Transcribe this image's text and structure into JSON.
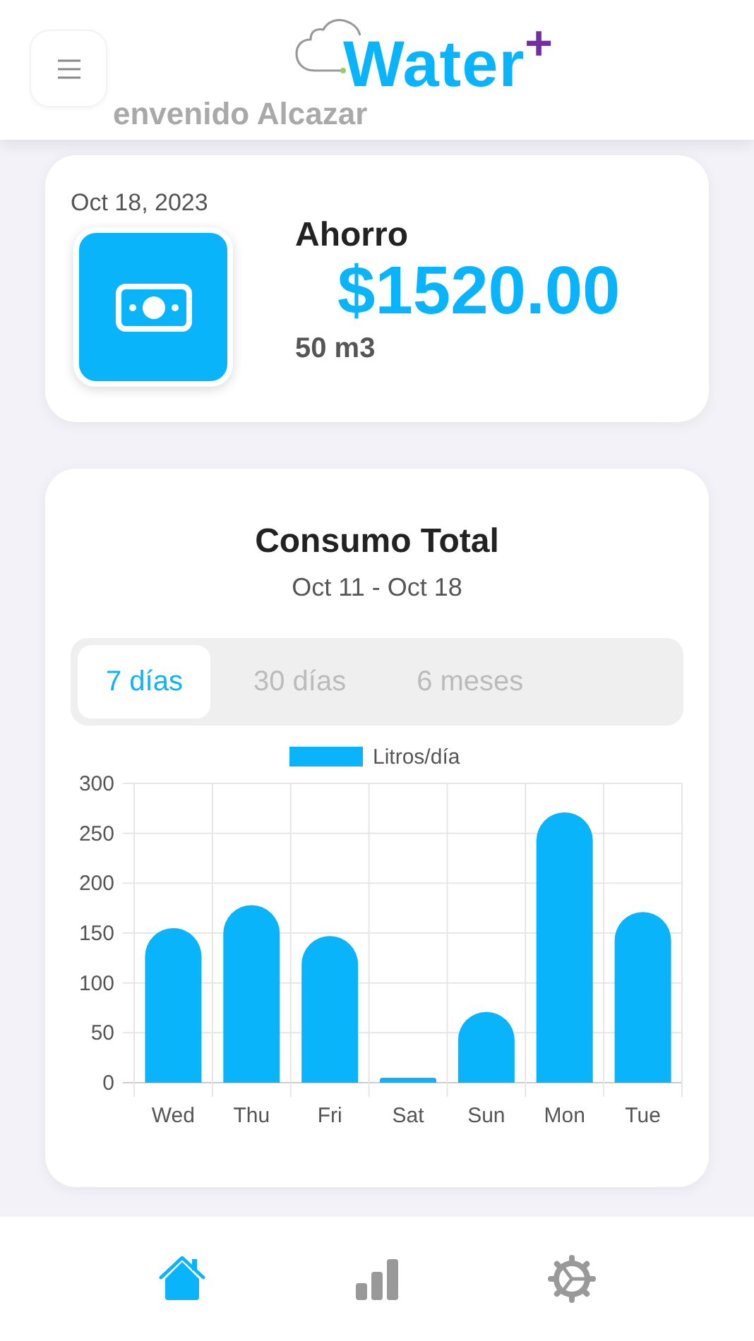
{
  "header": {
    "greeting": "envenido Alcazar",
    "logo": {
      "name": "Water",
      "mark": "+"
    }
  },
  "savings": {
    "date": "Oct 18, 2023",
    "title": "Ahorro",
    "amount": "$1520.00",
    "volume": "50 m3"
  },
  "consumption": {
    "title": "Consumo Total",
    "range": "Oct 11 - Oct 18",
    "tabs": [
      {
        "label": "7 días",
        "selected": true
      },
      {
        "label": "30 días",
        "selected": false
      },
      {
        "label": "6 meses",
        "selected": false
      }
    ],
    "chart_data": {
      "type": "bar",
      "categories": [
        "Wed",
        "Thu",
        "Fri",
        "Sat",
        "Sun",
        "Mon",
        "Tue"
      ],
      "series": [
        {
          "name": "Litros/día",
          "color": "#0ab4fb",
          "values": [
            155,
            178,
            147,
            5,
            71,
            271,
            171
          ]
        }
      ],
      "grid": true,
      "ylim": [
        0,
        300
      ],
      "yticks": [
        0,
        50,
        100,
        150,
        200,
        250,
        300
      ]
    }
  },
  "nav": [
    {
      "kind": "home",
      "selected": true
    },
    {
      "kind": "stats",
      "selected": false
    },
    {
      "kind": "settings",
      "selected": false
    }
  ]
}
